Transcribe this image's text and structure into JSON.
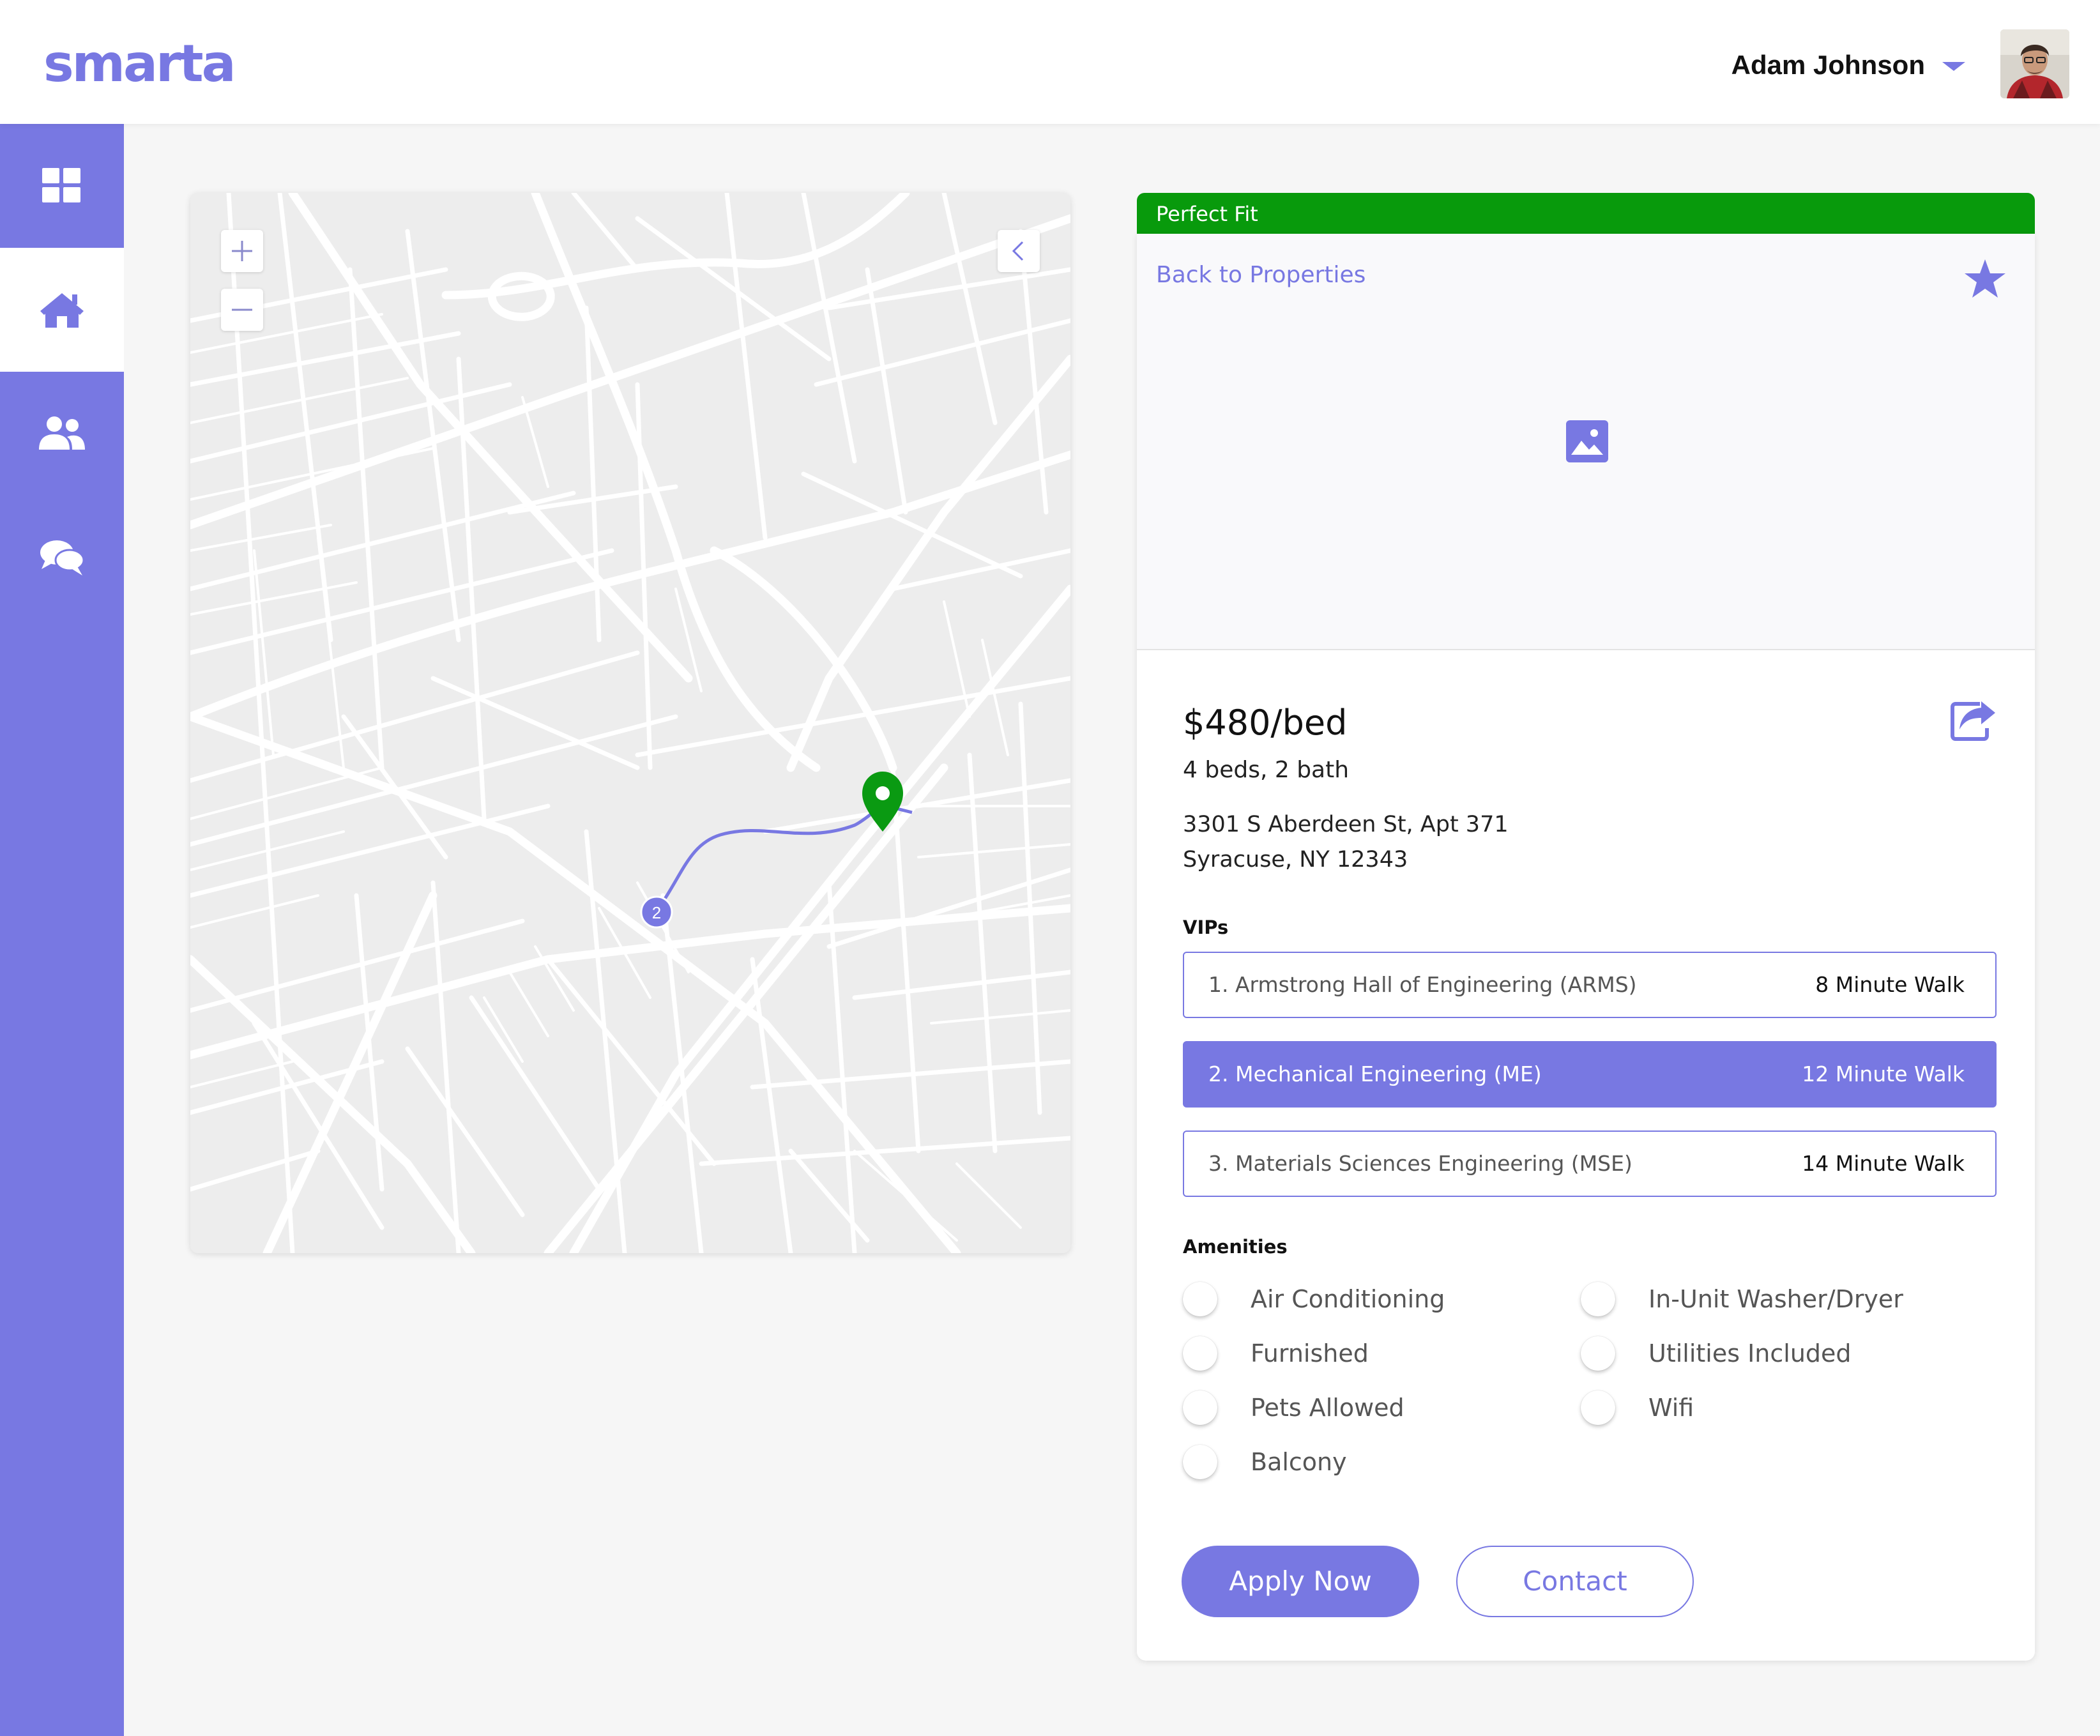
{
  "app": {
    "logo": "smarta"
  },
  "header": {
    "user_name": "Adam Johnson"
  },
  "sidebar": {
    "items": [
      {
        "name": "dashboard",
        "icon": "grid-icon",
        "active": false
      },
      {
        "name": "home",
        "icon": "home-icon",
        "active": true
      },
      {
        "name": "people",
        "icon": "users-icon",
        "active": false
      },
      {
        "name": "messages",
        "icon": "chat-icon",
        "active": false
      }
    ]
  },
  "map": {
    "zoom_in_icon": "plus-icon",
    "zoom_out_icon": "minus-icon",
    "collapse_icon": "chevron-left-icon",
    "marker_label": "2",
    "pin_icon": "location-pin-icon"
  },
  "listing": {
    "badge": "Perfect Fit",
    "back_label": "Back to Properties",
    "price": "$480/bed",
    "beds_baths": "4 beds, 2 bath",
    "address_line1": "3301 S Aberdeen St, Apt 371",
    "address_line2": "Syracuse, NY 12343",
    "vips_title": "VIPs",
    "vips": [
      {
        "name": "1. Armstrong Hall of Engineering (ARMS)",
        "walk": "8 Minute Walk",
        "selected": false
      },
      {
        "name": "2. Mechanical Engineering (ME)",
        "walk": "12 Minute Walk",
        "selected": true
      },
      {
        "name": "3. Materials Sciences Engineering (MSE)",
        "walk": "14 Minute Walk",
        "selected": false
      }
    ],
    "amenities_title": "Amenities",
    "amenities_left": [
      "Air Conditioning",
      "Furnished",
      "Pets Allowed",
      "Balcony"
    ],
    "amenities_right": [
      "In-Unit Washer/Dryer",
      "Utilities Included",
      "Wifi"
    ],
    "apply_label": "Apply Now",
    "contact_label": "Contact"
  },
  "colors": {
    "accent": "#7878e2",
    "badge_green": "#089a0c",
    "pin_green": "#0a9a12"
  }
}
